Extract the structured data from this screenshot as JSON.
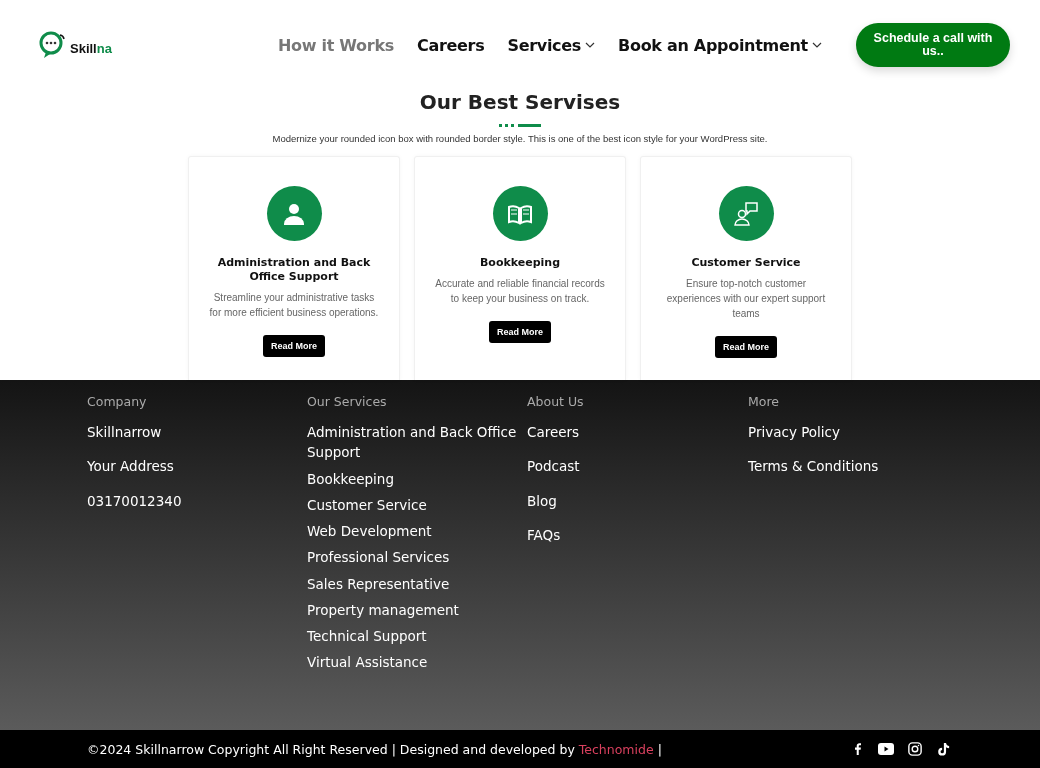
{
  "header": {
    "logo": {
      "main": "Skill",
      "accent": "na"
    },
    "nav": [
      {
        "label": "How it Works",
        "kind": "link",
        "selected": true
      },
      {
        "label": "Careers",
        "kind": "link",
        "selected": false
      },
      {
        "label": "Services",
        "kind": "dropdown",
        "selected": false
      },
      {
        "label": "Book an Appointment",
        "kind": "dropdown",
        "selected": false
      }
    ],
    "cta": "Schedule a call with us.."
  },
  "services": {
    "title": "Our Best Servises",
    "subtitle": "Modernize your rounded icon box with rounded border style. This is one of the best icon style for your WordPress site.",
    "cards": [
      {
        "kind": "person",
        "title": "Administration and Back Office Support",
        "text": "Streamline your administrative tasks for more efficient business operations.",
        "button": "Read More"
      },
      {
        "kind": "book",
        "title": "Bookkeeping",
        "text": "Accurate and reliable financial records to keep your business on track.",
        "button": "Read More"
      },
      {
        "kind": "chat",
        "title": "Customer Service",
        "text": "Ensure top-notch customer experiences with our expert support teams",
        "button": "Read More"
      }
    ]
  },
  "footer": {
    "columns": [
      {
        "heading": "Company",
        "links": [
          "Skillnarrow",
          "Your Address",
          "03170012340"
        ]
      },
      {
        "heading": "Our Services",
        "links": [
          "Administration and Back Office Support",
          "Bookkeeping",
          "Customer Service",
          "Web Development",
          "Professional Services",
          "Sales Representative",
          "Property management",
          "Technical Support",
          "Virtual Assistance"
        ]
      },
      {
        "heading": "About Us",
        "links": [
          "Careers",
          "Podcast",
          "Blog",
          "FAQs"
        ]
      },
      {
        "heading": "More",
        "links": [
          "Privacy Policy",
          "Terms & Conditions"
        ]
      }
    ],
    "copyright": "©2024 Skillnarrow Copyright All Right Reserved | Designed and developed by",
    "developer": "Technomide",
    "separator": "|",
    "social": [
      {
        "kind": "facebook"
      },
      {
        "kind": "youtube"
      },
      {
        "kind": "instagram"
      },
      {
        "kind": "tiktok"
      }
    ]
  }
}
